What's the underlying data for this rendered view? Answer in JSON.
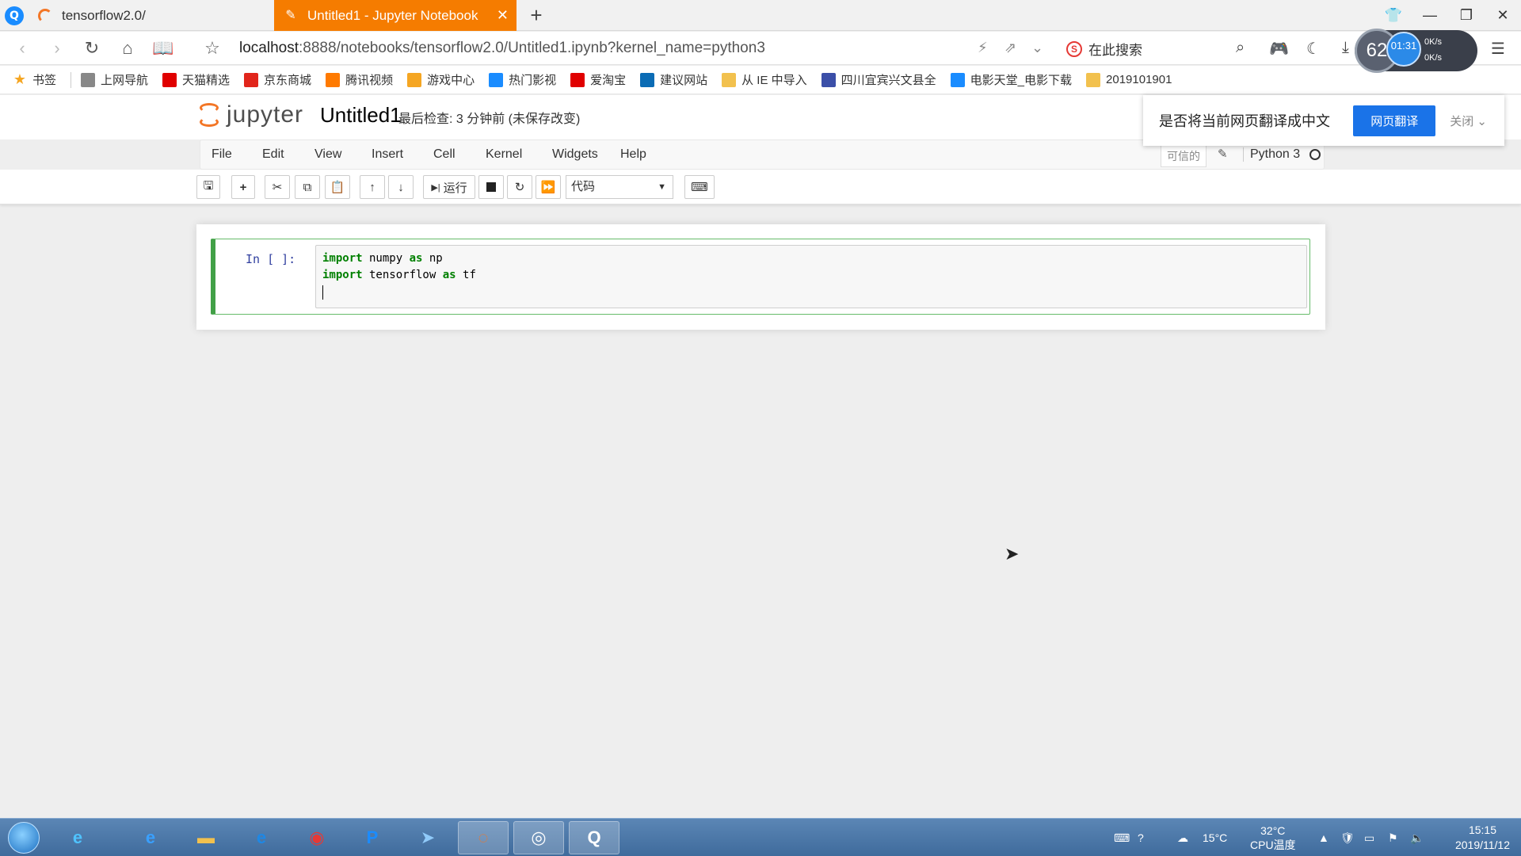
{
  "browser": {
    "tabs": [
      {
        "label": "tensorflow2.0/"
      },
      {
        "label": "Untitled1 - Jupyter Notebook"
      }
    ],
    "url_host": "localhost",
    "url_rest": ":8888/notebooks/tensorflow2.0/Untitled1.ipynb?kernel_name=python3",
    "search_placeholder": "在此搜索",
    "speed": {
      "ring": "62",
      "time": "01:31",
      "up": "0K/s",
      "down": "0K/s"
    },
    "bookmarks": [
      {
        "label": "书签",
        "icon": "star-icon",
        "color": "#f5a623"
      },
      {
        "label": "上网导航",
        "icon": "globe-icon",
        "color": "#888888"
      },
      {
        "label": "天猫精选",
        "icon": "tmall-icon",
        "color": "#e00000"
      },
      {
        "label": "京东商城",
        "icon": "jd-icon",
        "color": "#e1251b"
      },
      {
        "label": "腾讯视频",
        "icon": "tencent-video-icon",
        "color": "#ff7a00"
      },
      {
        "label": "游戏中心",
        "icon": "game-center-icon",
        "color": "#f5a623"
      },
      {
        "label": "热门影视",
        "icon": "video-icon",
        "color": "#1a8cff"
      },
      {
        "label": "爱淘宝",
        "icon": "taobao-icon",
        "color": "#e00000"
      },
      {
        "label": "建议网站",
        "icon": "bing-icon",
        "color": "#0b6cb5"
      },
      {
        "label": "从 IE 中导入",
        "icon": "folder-icon",
        "color": "#f2c14e"
      },
      {
        "label": "四川宜宾兴文县全",
        "icon": "site-icon",
        "color": "#3b4fa8"
      },
      {
        "label": "电影天堂_电影下载",
        "icon": "shield-site-icon",
        "color": "#1a8cff"
      },
      {
        "label": "2019101901",
        "icon": "page-icon",
        "color": "#f2c14e"
      }
    ]
  },
  "translate": {
    "prompt": "是否将当前网页翻译成中文",
    "button": "网页翻译",
    "close": "关闭"
  },
  "jupyter": {
    "logo_text": "jupyter",
    "notebook_name": "Untitled1",
    "checkpoint": "最后检查: 3 分钟前  (未保存改变)",
    "menu": [
      "File",
      "Edit",
      "View",
      "Insert",
      "Cell",
      "Kernel",
      "Widgets",
      "Help"
    ],
    "trusted": "可信的",
    "kernel": "Python 3",
    "toolbar": {
      "run_label": "运行",
      "cell_type": "代码"
    },
    "cell": {
      "prompt": "In [ ]:",
      "lines": [
        {
          "kw1": "import",
          "t1": " numpy ",
          "kw2": "as",
          "t2": " np"
        },
        {
          "kw1": "import",
          "t1": " tensorflow ",
          "kw2": "as",
          "t2": " tf"
        }
      ]
    }
  },
  "taskbar": {
    "weather_temp": "15°C",
    "cpu_temp": "32°C",
    "cpu_label": "CPU温度",
    "time": "15:15",
    "date": "2019/11/12"
  }
}
